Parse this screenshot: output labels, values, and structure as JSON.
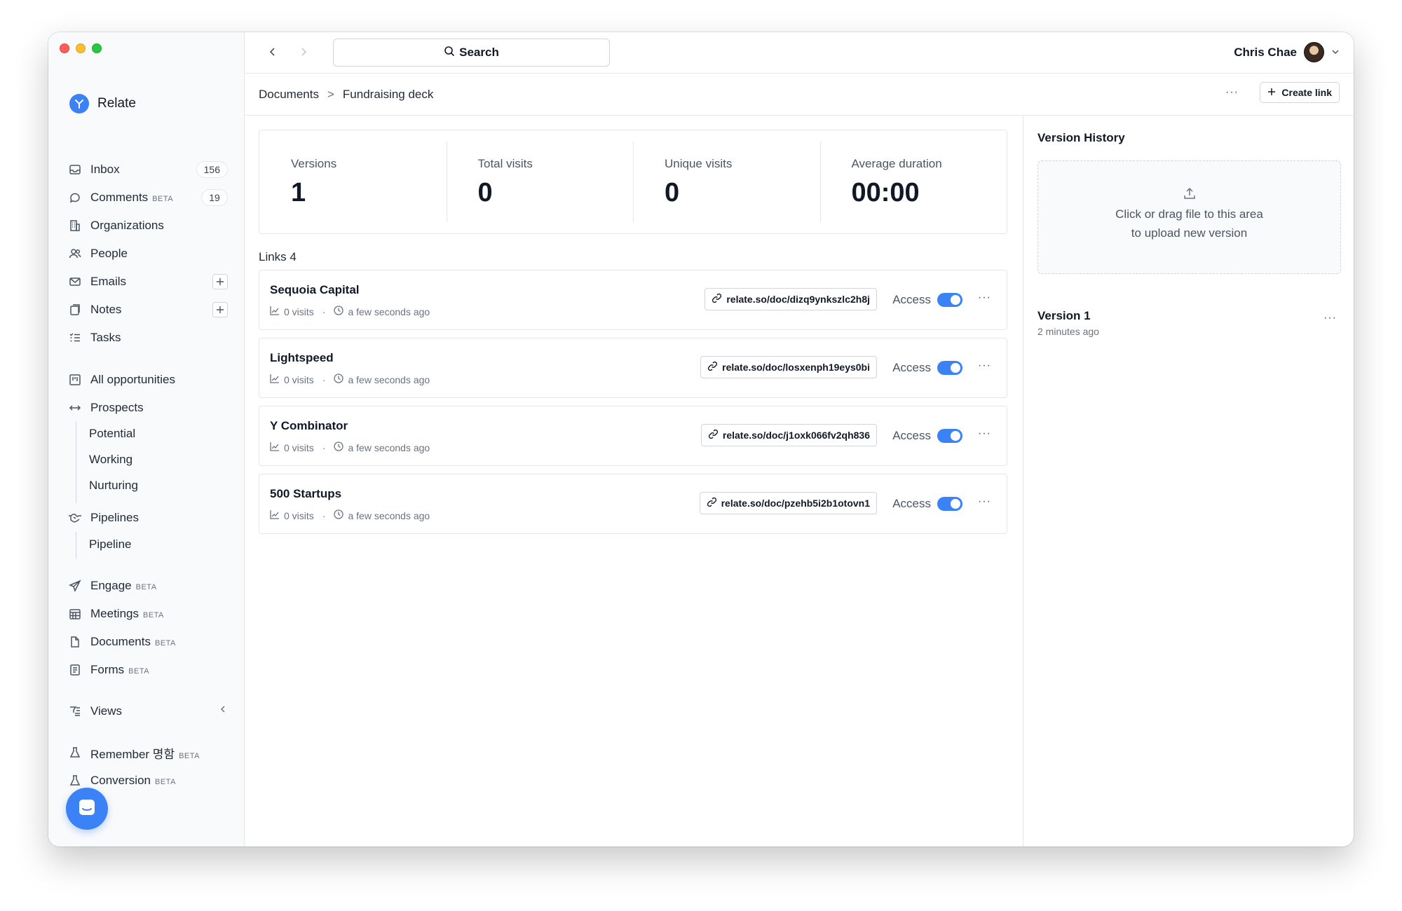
{
  "app": {
    "name": "Relate"
  },
  "sidebar": {
    "items": [
      {
        "label": "Inbox",
        "icon": "inbox-icon",
        "count": "156"
      },
      {
        "label": "Comments",
        "icon": "comment-icon",
        "beta": "BETA",
        "count": "19"
      },
      {
        "label": "Organizations",
        "icon": "building-icon"
      },
      {
        "label": "People",
        "icon": "people-icon"
      },
      {
        "label": "Emails",
        "icon": "mail-icon"
      },
      {
        "label": "Notes",
        "icon": "notes-icon"
      },
      {
        "label": "Tasks",
        "icon": "tasks-icon"
      },
      {
        "label": "All opportunities",
        "icon": "kanban-icon"
      },
      {
        "label": "Prospects",
        "icon": "arrows-horizontal-icon"
      },
      {
        "label": "Pipelines",
        "icon": "handshake-icon"
      },
      {
        "label": "Engage",
        "icon": "send-icon",
        "beta": "BETA"
      },
      {
        "label": "Meetings",
        "icon": "calendar-icon",
        "beta": "BETA"
      },
      {
        "label": "Documents",
        "icon": "document-icon",
        "beta": "BETA"
      },
      {
        "label": "Forms",
        "icon": "form-icon",
        "beta": "BETA"
      },
      {
        "label": "Views",
        "icon": "filter-list-icon"
      },
      {
        "label": "Remember 명함",
        "icon": "flask-icon",
        "beta": "BETA"
      },
      {
        "label": "Conversion",
        "icon": "flask-icon",
        "beta": "BETA"
      }
    ],
    "prospects_sub": [
      "Potential",
      "Working",
      "Nurturing"
    ],
    "pipelines_sub": [
      "Pipeline"
    ]
  },
  "topbar": {
    "search_label": "Search",
    "user_name": "Chris Chae"
  },
  "breadcrumb": {
    "root": "Documents",
    "separator": ">",
    "current": "Fundraising deck",
    "more": "···",
    "create_link": "Create link"
  },
  "stats": [
    {
      "label": "Versions",
      "value": "1"
    },
    {
      "label": "Total visits",
      "value": "0"
    },
    {
      "label": "Unique visits",
      "value": "0"
    },
    {
      "label": "Average duration",
      "value": "00:00"
    }
  ],
  "links": {
    "title": "Links 4",
    "rows": [
      {
        "name": "Sequoia Capital",
        "visits": "0 visits",
        "time": "a few seconds ago",
        "url": "relate.so/doc/dizq9ynkszlc2h8j",
        "access": "Access",
        "enabled": true
      },
      {
        "name": "Lightspeed",
        "visits": "0 visits",
        "time": "a few seconds ago",
        "url": "relate.so/doc/losxenph19eys0bi",
        "access": "Access",
        "enabled": true
      },
      {
        "name": "Y Combinator",
        "visits": "0 visits",
        "time": "a few seconds ago",
        "url": "relate.so/doc/j1oxk066fv2qh836",
        "access": "Access",
        "enabled": true
      },
      {
        "name": "500 Startups",
        "visits": "0 visits",
        "time": "a few seconds ago",
        "url": "relate.so/doc/pzehb5i2b1otovn1",
        "access": "Access",
        "enabled": true
      }
    ]
  },
  "version_history": {
    "title": "Version History",
    "upload_line1": "Click or drag file to this area",
    "upload_line2": "to upload new version",
    "versions": [
      {
        "name": "Version 1",
        "time": "2 minutes ago"
      }
    ]
  },
  "colors": {
    "accent": "#3b82f6",
    "border": "#e5e7eb",
    "sidebar_bg": "#f9fafb"
  }
}
